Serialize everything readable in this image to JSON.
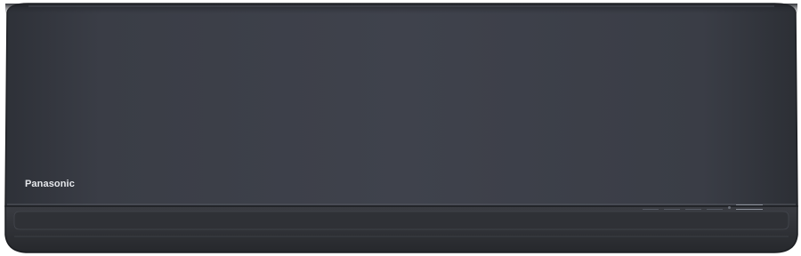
{
  "product": {
    "brand_logo": "Panasonic",
    "type": "wall-mounted air conditioner indoor unit",
    "finish_color": "#3b3e46",
    "accent_color": "#2c2e33"
  },
  "indicators": [
    {
      "icon": "indicator-lamp-1"
    },
    {
      "icon": "indicator-lamp-2"
    },
    {
      "icon": "indicator-lamp-3"
    },
    {
      "icon": "indicator-lamp-4"
    },
    {
      "icon": "sensor-icon"
    },
    {
      "icon": "nanoe-badge-icon"
    }
  ]
}
